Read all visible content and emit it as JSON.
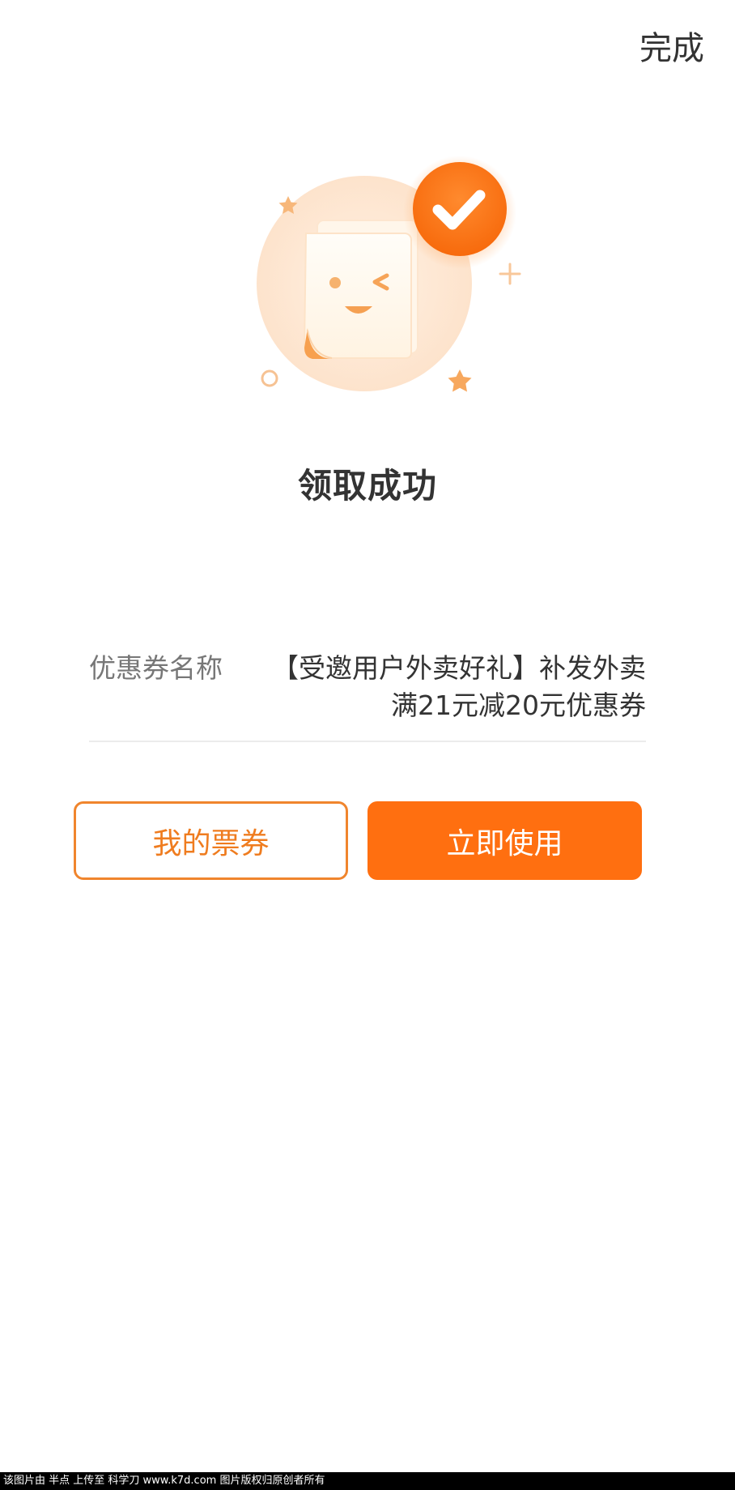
{
  "header": {
    "done_label": "完成"
  },
  "result": {
    "title": "领取成功"
  },
  "coupon": {
    "label": "优惠券名称",
    "value_line1": "【受邀用户外卖好礼】补发外卖",
    "value_line2": "满21元减20元优惠券"
  },
  "actions": {
    "my_coupons_label": "我的票券",
    "use_now_label": "立即使用"
  },
  "footer": {
    "watermark_text": "该图片由 半点 上传至 科学刀 www.k7d.com 图片版权归原创者所有"
  },
  "colors": {
    "accent": "#ff6f10",
    "accent_outline": "#f0852d",
    "text_primary": "#333333",
    "text_secondary": "#777777",
    "divider": "#ececec"
  },
  "icons": {
    "success_check": "check-icon",
    "ticket_illustration": "ticket-illustration"
  }
}
